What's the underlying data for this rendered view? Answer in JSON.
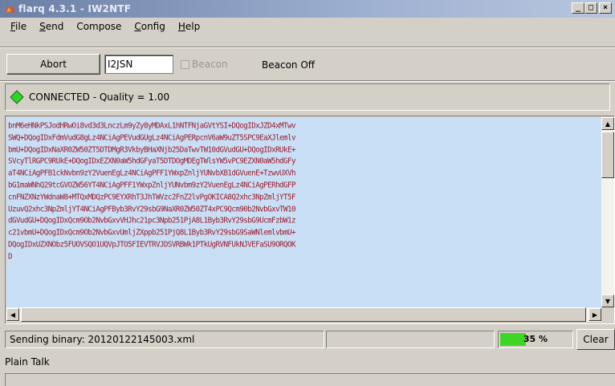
{
  "window": {
    "title": "flarq 4.3.1 - IW2NTF",
    "minimize": "_",
    "maximize": "□",
    "close": "×"
  },
  "menu": {
    "items": [
      {
        "label": "File",
        "key": "F",
        "rest": "ile"
      },
      {
        "label": "Send",
        "key": "S",
        "rest": "end"
      },
      {
        "label": "Compose",
        "key": "",
        "rest": "Compose"
      },
      {
        "label": "Config",
        "key": "C",
        "rest": "onfig"
      },
      {
        "label": "Help",
        "key": "H",
        "rest": "elp"
      }
    ]
  },
  "toolbar": {
    "abort_label": "Abort",
    "callsign_value": "I2JSN",
    "beacon_label": "Beacon",
    "beacon_status": "Beacon Off"
  },
  "connection": {
    "status_text": "CONNECTED - Quality = 1.00",
    "indicator_color": "#2fd42a"
  },
  "text_area": {
    "lines": [
      "bnM6eHNkPSJodHRwOi8vd3d3LnczLm9yZy8yMDAxL1hNTFNjaGVtYSI+DQogIDxJZD4xMTwv",
      "SWQ+DQogIDxFdmVudG8gLz4NCiAgPEVudGUgLz4NCiAgPERpcnV6aW9uZT5SPC9EaXJlemlv",
      "bmU+DQogIDxNaXR0ZW50ZT5DTDMgR3VkbyBHaXNjb25DaTwvTW10dGVudGU+DQogIDxRUkE+",
      "SVcyTlRGPC9RUkE+DQogIDxEZXN0aW5hdGFyaT5DTDOgMDEgTWlsYW5vPC9EZXN0aW5hdGFy",
      "aT4NCiAgPFB1ckNvbn9zY2VuenEgLz4NCiAgPFF1YWxpZnljYUNvbXB1dGVuenE+TzwvUXVh",
      "bG1maWNhQ29tcGVOZW56YT4NCiAgPFF1YWxpZnljYUNvbm9zY2VuenEgLz4NCiAgPERhdGFP",
      "cnFNZXNzYWdnaW8+MTQxMDQzPC9EYXRhT3JhTWVzc2FnZ2lvPgOKICA8Q2xhc3NpZmljYT5F",
      "UzuvQ2xhc3NpZmljYT4NCiAgPFByb3RvY29sbG9NaXR0ZW50ZT4xPC9Qcm90b2NvbGxvTW10",
      "dGVudGU+DQogIDxQcm9Ob2NvbGxvVHJhc21pc3Npb251PjA8L1Byb3RvY29sbG9UcmFzbW1z",
      "c21vbmU+DQogIDxQcm9Ob2NvbGxvUmljZXppb251PjQ8L1Byb3RvY29sbG9SaWNlemlvbmU+",
      "DQogIDxUZXNObz5FUOVSQO1UQVpJTO5FIEVTRVJDSVRBWk1PTkUgRVNFUkNJVEFaSU9ORQOK",
      "D"
    ]
  },
  "status": {
    "message": "Sending binary: 20120122145003.xml",
    "progress_percent": 35,
    "progress_label": "35 %",
    "clear_label": "Clear",
    "progress_color": "#3ed625"
  },
  "plain_talk": {
    "label": "Plain Talk"
  }
}
